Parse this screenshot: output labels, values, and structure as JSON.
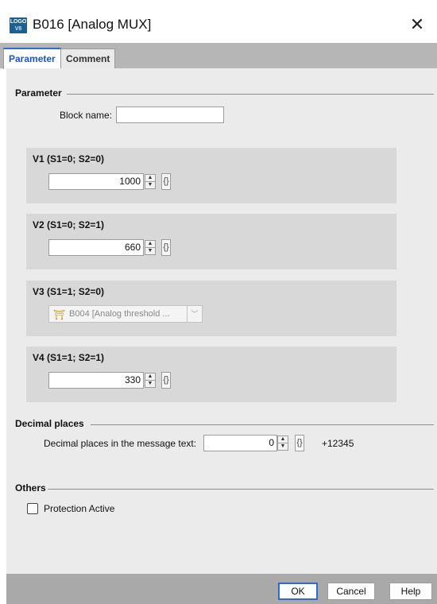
{
  "window": {
    "title": "B016 [Analog MUX]",
    "icon_text_top": "LOGO",
    "icon_text_bottom": "V8",
    "close_glyph": "✕"
  },
  "tabs": [
    {
      "label": "Parameter",
      "active": true
    },
    {
      "label": "Comment",
      "active": false
    }
  ],
  "parameter": {
    "section_title": "Parameter",
    "block_name_label": "Block name:",
    "block_name_value": "",
    "v1": {
      "title": "V1 (S1=0; S2=0)",
      "value": "1000",
      "brace": "{}"
    },
    "v2": {
      "title": "V2 (S1=0; S2=1)",
      "value": "660",
      "brace": "{}"
    },
    "v3": {
      "title": "V3 (S1=1; S2=0)",
      "selected": "B004 [Analog threshold ...",
      "icon": "threshold-block-icon"
    },
    "v4": {
      "title": "V4 (S1=1; S2=1)",
      "value": "330",
      "brace": "{}"
    }
  },
  "decimal": {
    "section_title": "Decimal places",
    "label": "Decimal places in the message text:",
    "value": "0",
    "brace": "{}",
    "preview": "+12345"
  },
  "others": {
    "section_title": "Others",
    "protection_label": "Protection Active",
    "protection_checked": false
  },
  "footer": {
    "ok": "OK",
    "cancel": "Cancel",
    "help": "Help"
  }
}
